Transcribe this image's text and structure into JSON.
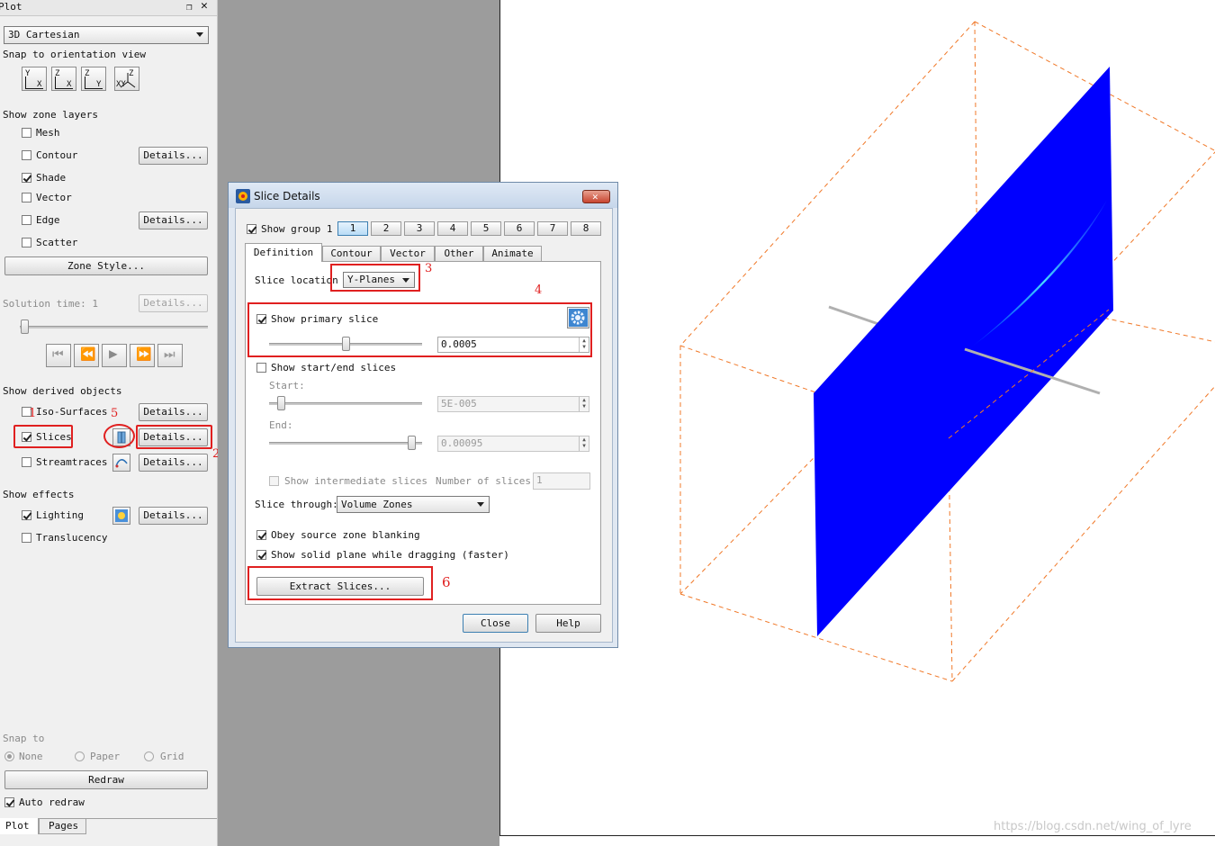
{
  "panel": {
    "title": "Plot",
    "plot_type": "3D Cartesian",
    "snap_orientation_label": "Snap to orientation view",
    "orient_buttons": [
      {
        "top": "Y",
        "bottom": "X"
      },
      {
        "top": "Z",
        "bottom": "X"
      },
      {
        "top": "Z",
        "bottom": "Y"
      },
      {
        "top": "Z",
        "bottom": "XY"
      }
    ],
    "zone_layers_label": "Show zone layers",
    "zone_layers": [
      {
        "label": "Mesh",
        "checked": false
      },
      {
        "label": "Contour",
        "checked": false
      },
      {
        "label": "Shade",
        "checked": true
      },
      {
        "label": "Vector",
        "checked": false
      },
      {
        "label": "Edge",
        "checked": false
      },
      {
        "label": "Scatter",
        "checked": false
      }
    ],
    "details_label": "Details...",
    "zone_style_label": "Zone Style...",
    "solution_time_label": "Solution time: 1",
    "derived_label": "Show derived objects",
    "derived": [
      {
        "label": "Iso-Surfaces",
        "checked": false
      },
      {
        "label": "Slices",
        "checked": true
      },
      {
        "label": "Streamtraces",
        "checked": false
      }
    ],
    "effects_label": "Show effects",
    "effects": [
      {
        "label": "Lighting",
        "checked": true
      },
      {
        "label": "Translucency",
        "checked": false
      }
    ],
    "snap_to_label": "Snap to",
    "snap_options": [
      "None",
      "Paper",
      "Grid"
    ],
    "redraw_label": "Redraw",
    "auto_redraw_label": "Auto redraw",
    "bottom_tabs": [
      "Plot",
      "Pages"
    ]
  },
  "dialog": {
    "title": "Slice Details",
    "show_group_label": "Show group 1",
    "groups": [
      "1",
      "2",
      "3",
      "4",
      "5",
      "6",
      "7",
      "8"
    ],
    "tabs": [
      "Definition",
      "Contour",
      "Vector",
      "Other",
      "Animate"
    ],
    "slice_location_label": "Slice location",
    "slice_location_value": "Y-Planes",
    "show_primary_label": "Show primary slice",
    "primary_value": "0.0005",
    "primary_slider": 0.5,
    "show_start_end_label": "Show start/end slices",
    "start_label": "Start:",
    "start_value": "5E-005",
    "end_label": "End:",
    "end_value": "0.00095",
    "show_intermediate_label": "Show intermediate slices",
    "num_slices_label": "Number of slices:",
    "num_slices_value": "1",
    "slice_through_label": "Slice through:",
    "slice_through_value": "Volume Zones",
    "obey_label": "Obey source zone blanking",
    "solid_plane_label": "Show solid plane while dragging (faster)",
    "extract_label": "Extract Slices...",
    "close_label": "Close",
    "help_label": "Help"
  },
  "annotations": [
    "1",
    "2",
    "3",
    "4",
    "5",
    "6"
  ],
  "watermark": "https://blog.csdn.net/wing_of_lyre",
  "colors": {
    "slice": "#0000ff",
    "bbox": "#f07828",
    "annotation": "#e02020"
  }
}
